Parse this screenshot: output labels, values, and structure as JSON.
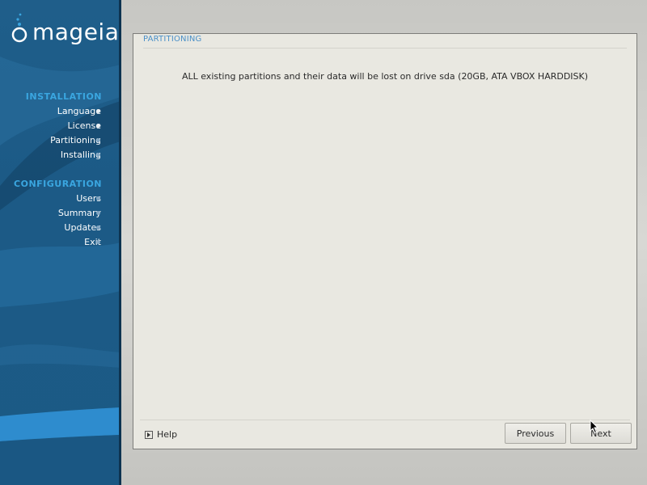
{
  "sidebar": {
    "logo_text": "mageia",
    "sections": [
      {
        "title": "INSTALLATION",
        "steps": [
          {
            "label": "Language",
            "state": "done"
          },
          {
            "label": "License",
            "state": "done"
          },
          {
            "label": "Partitioning",
            "state": "current"
          },
          {
            "label": "Installing",
            "state": "todo"
          }
        ]
      },
      {
        "title": "CONFIGURATION",
        "steps": [
          {
            "label": "Users",
            "state": "todo"
          },
          {
            "label": "Summary",
            "state": "todo"
          },
          {
            "label": "Updates",
            "state": "todo"
          },
          {
            "label": "Exit",
            "state": "todo"
          }
        ]
      }
    ]
  },
  "panel": {
    "title": "PARTITIONING",
    "message": "ALL existing partitions and their data will be lost on drive sda (20GB, ATA VBOX HARDDISK)",
    "help_label": "Help",
    "previous_label": "Previous",
    "next_label": "Next"
  },
  "colors": {
    "sidebar_bg": "#1f5e8a",
    "section_title": "#3aa6e0",
    "panel_bg": "#e9e8e1",
    "panel_title": "#4a90c8"
  }
}
